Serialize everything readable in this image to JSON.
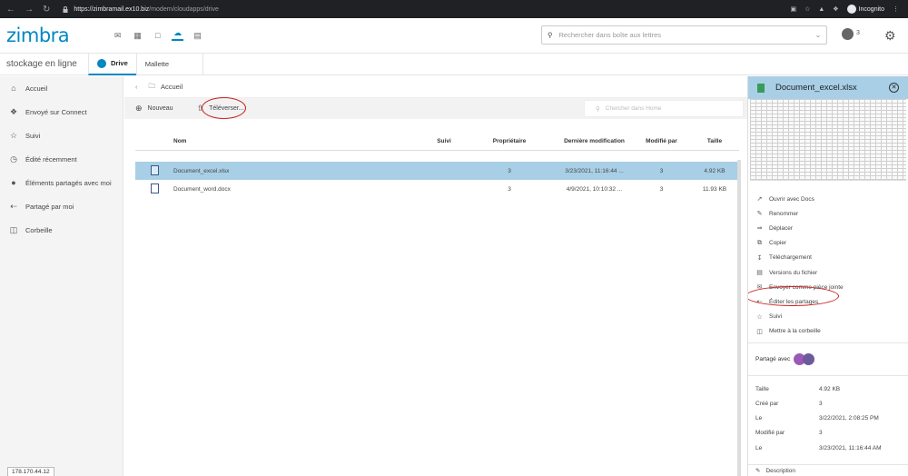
{
  "browser": {
    "url_host": "https://zimbramail.ex10.biz",
    "url_path": "/modern/cloudapps/drive",
    "profile_label": "Incognito"
  },
  "header": {
    "logo": "zimbra",
    "search_placeholder": "Rechercher dans boîte aux lettres",
    "avatar_label": "3",
    "app_icons": [
      "mail-icon",
      "calendar-icon",
      "chat-icon",
      "cloud-icon",
      "contacts-icon"
    ],
    "brand_color": "#0087c3"
  },
  "subheader": {
    "app_name": "stockage en ligne",
    "tabs": [
      {
        "label": "Drive",
        "active": true
      },
      {
        "label": "Mallette",
        "active": false
      }
    ]
  },
  "sidebar": {
    "items": [
      {
        "label": "Accueil",
        "icon": "home-icon"
      },
      {
        "label": "Envoyé sur Connect",
        "icon": "connect-icon"
      },
      {
        "label": "Suivi",
        "icon": "star-icon"
      },
      {
        "label": "Édité récemment",
        "icon": "clock-icon"
      },
      {
        "label": "Éléments partagés avec moi",
        "icon": "people-icon"
      },
      {
        "label": "Partagé par moi",
        "icon": "share-icon"
      },
      {
        "label": "Corbeille",
        "icon": "trash-icon"
      }
    ],
    "status_ip": "178.170.44.12"
  },
  "main": {
    "breadcrumb": "Accueil",
    "toolbar": {
      "new_label": "Nouveau",
      "upload_label": "Téléverser...",
      "search_placeholder": "Chercher dans Home"
    },
    "columns": [
      "Nom",
      "Suivi",
      "Propriétaire",
      "Dernière modification",
      "Modifié par",
      "Taille"
    ],
    "rows": [
      {
        "name": "Document_excel.xlsx",
        "suivi": "",
        "owner": "3",
        "modified": "3/23/2021, 11:16:44 ...",
        "modified_by": "3",
        "size": "4.92 KB",
        "selected": true
      },
      {
        "name": "Document_word.docx",
        "suivi": "",
        "owner": "3",
        "modified": "4/9/2021, 10:10:32 ...",
        "modified_by": "3",
        "size": "11.93 KB",
        "selected": false
      }
    ]
  },
  "panel": {
    "title": "Document_excel.xlsx",
    "actions": [
      {
        "label": "Ouvrir avec Docs",
        "icon": "external-icon"
      },
      {
        "label": "Renommer",
        "icon": "pencil-icon"
      },
      {
        "label": "Déplacer",
        "icon": "move-icon"
      },
      {
        "label": "Copier",
        "icon": "copy-icon"
      },
      {
        "label": "Téléchargement",
        "icon": "download-icon"
      },
      {
        "label": "Versions du fichier",
        "icon": "versions-icon"
      },
      {
        "label": "Envoyer comme pièce jointe",
        "icon": "mail-icon"
      },
      {
        "label": "Éditer les partages",
        "icon": "share-icon"
      },
      {
        "label": "Suivi",
        "icon": "star-icon"
      },
      {
        "label": "Mettre à la corbeille",
        "icon": "trash-icon"
      }
    ],
    "shared_with_label": "Partagé avec",
    "share_avatar_colors": [
      "#9b59b6",
      "#6c5a9a"
    ],
    "properties": [
      {
        "key": "Taille",
        "value": "4.92 KB"
      },
      {
        "key": "Créé par",
        "value": "3"
      },
      {
        "key": "Le",
        "value": "3/22/2021, 2:08:25 PM"
      },
      {
        "key": "Modifié par",
        "value": "3"
      },
      {
        "key": "Le",
        "value": "3/23/2021, 11:16:44 AM"
      }
    ],
    "description_label": "Description"
  },
  "highlight_color": "#c81e1e"
}
